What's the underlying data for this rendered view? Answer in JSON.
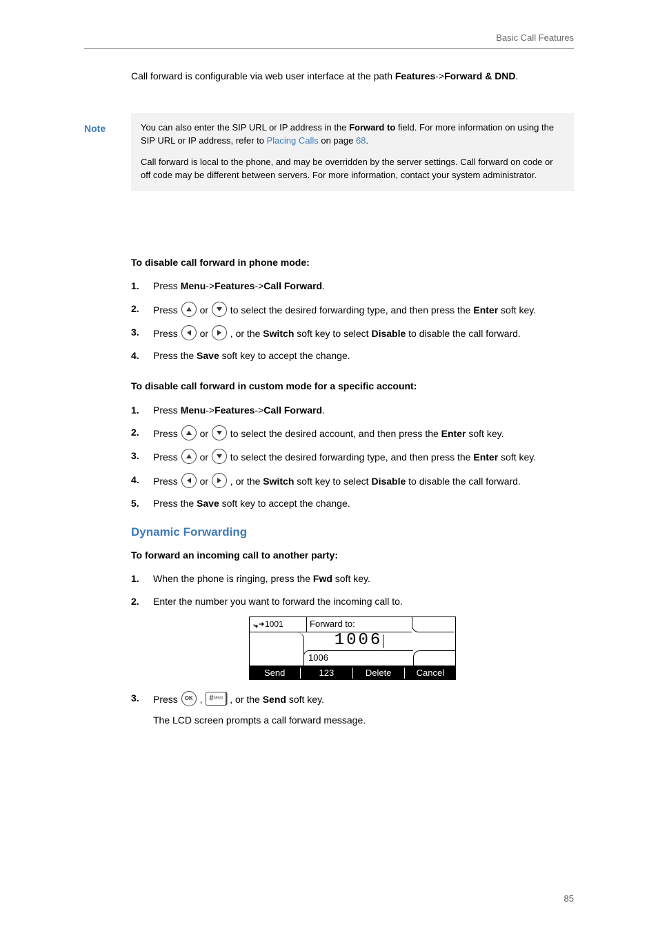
{
  "header": {
    "running": "Basic Call Features"
  },
  "intro": {
    "config_path_pre": "Call forward is configurable via web user interface at the path ",
    "config_path_b1": "Features",
    "config_path_sep": "->",
    "config_path_b2": "Forward & DND",
    "config_path_post": "."
  },
  "note": {
    "label": "Note",
    "p1_pre": "You can also enter the SIP URL or IP address in the ",
    "p1_b": "Forward to",
    "p1_mid": " field. For more information on using the SIP URL or IP address, refer to ",
    "p1_link": "Placing Calls",
    "p1_mid2": " on page ",
    "p1_page": "68",
    "p1_post": ".",
    "p2": "Call forward is local to the phone, and may be overridden by the server settings. Call forward on code or off code may be different between servers. For more information, contact your system administrator."
  },
  "secA": {
    "heading": "To disable call forward in phone mode:",
    "steps": [
      {
        "n": "1.",
        "pre": "Press ",
        "b1": "Menu",
        "s1": "->",
        "b2": "Features",
        "s2": "->",
        "b3": "Call Forward",
        "post": "."
      },
      {
        "n": "2.",
        "pre": "Press ",
        "keys": "ud",
        "mid": " to select the desired forwarding type, and then press the ",
        "b1": "Enter",
        "post": " soft key."
      },
      {
        "n": "3.",
        "pre": "Press ",
        "keys": "lr",
        "mid": " , or the ",
        "b1": "Switch",
        "mid2": " soft key to select ",
        "b2": "Disable",
        "post": " to disable the call forward."
      },
      {
        "n": "4.",
        "pre": "Press the ",
        "b1": "Save",
        "post": " soft key to accept the change."
      }
    ]
  },
  "secB": {
    "heading": "To disable call forward in custom mode for a specific account:",
    "steps": [
      {
        "n": "1.",
        "pre": "Press ",
        "b1": "Menu",
        "s1": "->",
        "b2": "Features",
        "s2": "->",
        "b3": "Call Forward",
        "post": "."
      },
      {
        "n": "2.",
        "pre": "Press ",
        "keys": "ud",
        "mid": " to select the desired account, and then press the ",
        "b1": "Enter",
        "post": " soft key."
      },
      {
        "n": "3.",
        "pre": "Press ",
        "keys": "ud",
        "mid": " to select the desired forwarding type, and then press the ",
        "b1": "Enter",
        "post": " soft key."
      },
      {
        "n": "4.",
        "pre": "Press ",
        "keys": "lr",
        "mid": " , or the ",
        "b1": "Switch",
        "mid2": " soft key to select ",
        "b2": "Disable",
        "post": " to disable the call forward."
      },
      {
        "n": "5.",
        "pre": "Press the ",
        "b1": "Save",
        "post": " soft key to accept the change."
      }
    ]
  },
  "secC": {
    "h2": "Dynamic Forwarding",
    "heading": "To forward an incoming call to another party:",
    "s1": {
      "n": "1.",
      "pre": "When the phone is ringing, press the ",
      "b1": "Fwd",
      "post": " soft key."
    },
    "s2": {
      "n": "2.",
      "t": "Enter the number you want to forward the incoming call to."
    },
    "s3": {
      "n": "3.",
      "pre": "Press ",
      "mid": " , ",
      "mid2": " , or the ",
      "b1": "Send",
      "post": " soft key."
    },
    "tail": "The LCD screen prompts a call forward message."
  },
  "shot": {
    "line_in": "1001",
    "title": "Forward to:",
    "big": "1006",
    "small": "1006",
    "soft": [
      "Send",
      "123",
      "Delete",
      "Cancel"
    ]
  },
  "pound": "#",
  "sendsub": "SEND",
  "pagenum": "85"
}
